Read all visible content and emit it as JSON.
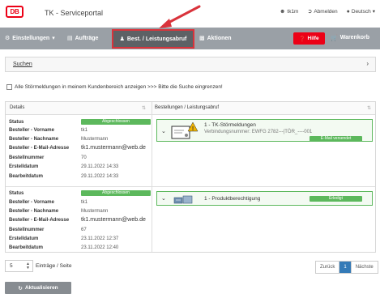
{
  "header": {
    "logo_text": "DB",
    "title": "TK - Serviceportal",
    "user_label": "tk1m",
    "logout_label": "Abmelden",
    "language_label": "Deutsch"
  },
  "nav": {
    "einstellungen_label": "Einstellungen",
    "auftraege_label": "Aufträge",
    "active_label": "Best. / Leistungsabruf",
    "aktionen_label": "Aktionen",
    "hilfe_label": "Hilfe",
    "warenkorb_label": "Warenkorb"
  },
  "search": {
    "label": "Suchen",
    "checkbox_label": "Alle Störmeldungen in meinem Kundenbereich anzeigen >>> Bitte die Suche eingrenzen!"
  },
  "table": {
    "header_details": "Details",
    "header_orders": "Bestellungen / Leistungsabruf",
    "labels": {
      "status": "Status",
      "vorname": "Besteller - Vorname",
      "nachname": "Besteller - Nachname",
      "email": "Besteller - E-Mail-Adresse",
      "nummer": "Bestellnummer",
      "erstell": "Erstelldatum",
      "bearbeit": "Bearbeitdatum"
    },
    "records": [
      {
        "status": "Abgeschlossen",
        "vorname": "tk1",
        "nachname": "Mustermann",
        "email": "tk1.mustermann@web.de",
        "nummer": "70",
        "erstell": "29.11.2022 14:33",
        "bearbeit": "29.11.2022 14:33",
        "card_title": "1 - TK-Störmeldungen",
        "card_sub": "Verbindungsnummer: EWFG 2782---|TÖR_----001",
        "card_status": "E-Mail versendet"
      },
      {
        "status": "Abgeschlossen",
        "vorname": "tk1",
        "nachname": "Mustermann",
        "email": "tk1.mustermann@web.de",
        "nummer": "67",
        "erstell": "23.11.2022 12:37",
        "bearbeit": "23.11.2022 12:40",
        "card_title": "1 - Produktberechtigung",
        "card_sub": "",
        "card_status": "Erledigt"
      }
    ]
  },
  "footer": {
    "page_size": "5",
    "page_size_label": "Einträge / Seite",
    "prev_label": "Zurück",
    "current_page": "1",
    "next_label": "Nächste",
    "refresh_label": "Aktualisieren"
  },
  "colors": {
    "brand_red": "#ec0016",
    "nav_gray": "#9aa0a6",
    "nav_active": "#5d6165",
    "success_green": "#5cb85c",
    "link_blue": "#337ab7"
  }
}
